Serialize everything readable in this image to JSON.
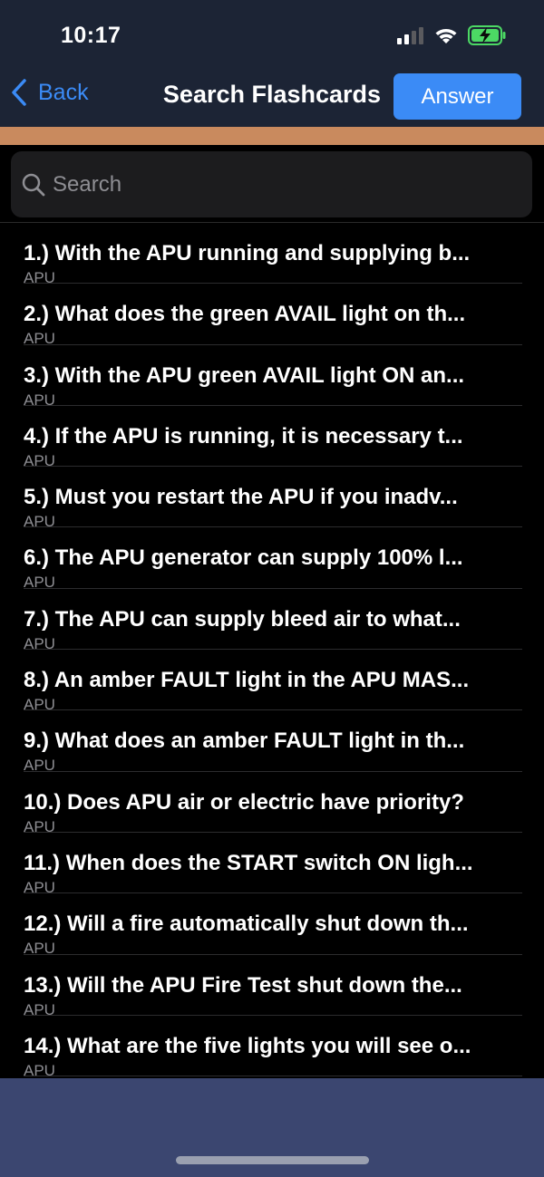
{
  "status": {
    "time": "10:17"
  },
  "nav": {
    "back_label": "Back",
    "title": "Search Flashcards",
    "answer_label": "Answer"
  },
  "search": {
    "placeholder": "Search",
    "value": ""
  },
  "items": [
    {
      "title": "1.) With the APU running and supplying b...",
      "category": "APU"
    },
    {
      "title": "2.) What does the green AVAIL light on th...",
      "category": "APU"
    },
    {
      "title": "3.) With the APU green AVAIL light ON an...",
      "category": "APU"
    },
    {
      "title": "4.) If the APU is running, it is necessary t...",
      "category": "APU"
    },
    {
      "title": "5.) Must you restart the APU if you inadv...",
      "category": "APU"
    },
    {
      "title": "6.) The APU generator can supply 100% l...",
      "category": "APU"
    },
    {
      "title": "7.) The APU can supply bleed air to what...",
      "category": "APU"
    },
    {
      "title": "8.) An amber FAULT light in the APU MAS...",
      "category": "APU"
    },
    {
      "title": "9.) What does an amber FAULT light in th...",
      "category": "APU"
    },
    {
      "title": "10.) Does APU air or electric have priority?",
      "category": "APU"
    },
    {
      "title": "11.) When does the START switch ON ligh...",
      "category": "APU"
    },
    {
      "title": "12.) Will a fire automatically shut down th...",
      "category": "APU"
    },
    {
      "title": "13.) Will the APU Fire Test shut down the...",
      "category": "APU"
    },
    {
      "title": "14.) What are the five lights you will see o...",
      "category": "APU"
    }
  ],
  "colors": {
    "nav_background": "#1c2435",
    "accent": "#3b8bf6",
    "strip": "#c98a5e",
    "bottom_bar": "#3b4670",
    "battery_fill": "#4cd964"
  },
  "icons": {
    "back": "chevron-left-icon",
    "search": "magnifier-icon",
    "signal": "cellular-signal-icon",
    "wifi": "wifi-icon",
    "battery": "battery-charging-icon"
  }
}
